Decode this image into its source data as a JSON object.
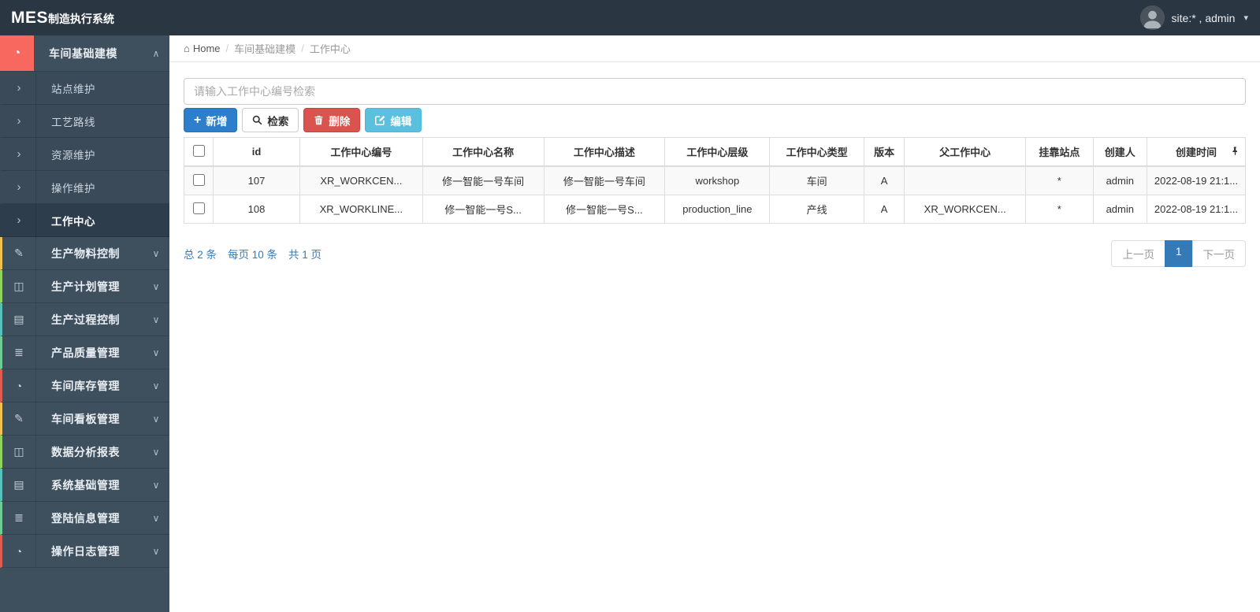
{
  "navbar": {
    "logo_bold": "MES",
    "logo_rest": "制造执行系统",
    "user_label": "site:* , admin"
  },
  "icons": {
    "home": "⌂",
    "chevron_up": "∧",
    "chevron_down": "∨",
    "chevron_right": "›",
    "caret_down": "▾",
    "plus": "+",
    "dashboard": "◔",
    "edit": "✎",
    "columns": "◫",
    "book": "▤",
    "list": "≣"
  },
  "sidebar": {
    "parent": {
      "label": "车间基础建模"
    },
    "sub_items": [
      {
        "label": "站点维护"
      },
      {
        "label": "工艺路线"
      },
      {
        "label": "资源维护"
      },
      {
        "label": "操作维护"
      },
      {
        "label": "工作中心"
      }
    ],
    "items": [
      {
        "label": "生产物料控制",
        "icon": "edit-icon",
        "accent": "#f0c052"
      },
      {
        "label": "生产计划管理",
        "icon": "columns-icon",
        "accent": "#92d35e"
      },
      {
        "label": "生产过程控制",
        "icon": "book-icon",
        "accent": "#56c2bc"
      },
      {
        "label": "产品质量管理",
        "icon": "list-icon",
        "accent": "#6ecc94"
      },
      {
        "label": "车间库存管理",
        "icon": "dashboard-icon",
        "accent": "#e05c51"
      },
      {
        "label": "车间看板管理",
        "icon": "edit-icon",
        "accent": "#f0c052"
      },
      {
        "label": "数据分析报表",
        "icon": "columns-icon",
        "accent": "#92d35e"
      },
      {
        "label": "系统基础管理",
        "icon": "book-icon",
        "accent": "#56c2bc"
      },
      {
        "label": "登陆信息管理",
        "icon": "list-icon",
        "accent": "#6ecc94"
      },
      {
        "label": "操作日志管理",
        "icon": "dashboard-icon",
        "accent": "#e05c51"
      }
    ]
  },
  "breadcrumb": {
    "home": "Home",
    "sep": "/",
    "crumb1": "车间基础建模",
    "crumb2": "工作中心"
  },
  "search": {
    "placeholder": "请输入工作中心编号检索",
    "value": ""
  },
  "toolbar": {
    "add_label": "新增",
    "search_label": "检索",
    "delete_label": "删除",
    "edit_label": "编辑"
  },
  "table": {
    "columns": [
      "id",
      "工作中心编号",
      "工作中心名称",
      "工作中心描述",
      "工作中心层级",
      "工作中心类型",
      "版本",
      "父工作中心",
      "挂靠站点",
      "创建人",
      "创建时间"
    ],
    "rows": [
      [
        "107",
        "XR_WORKCEN...",
        "修一智能一号车间",
        "修一智能一号车间",
        "workshop",
        "车间",
        "A",
        "",
        "*",
        "admin",
        "2022-08-19 21:1..."
      ],
      [
        "108",
        "XR_WORKLINE...",
        "修一智能一号S...",
        "修一智能一号S...",
        "production_line",
        "产线",
        "A",
        "XR_WORKCEN...",
        "*",
        "admin",
        "2022-08-19 21:1..."
      ]
    ]
  },
  "pagination": {
    "total": "总 2 条",
    "per_page": "每页 10 条",
    "pages": "共 1 页",
    "prev": "上一页",
    "current": "1",
    "next": "下一页"
  },
  "colors": {
    "navbar_bg": "#2b3643",
    "sidebar_bg": "#3e4f5e",
    "active_icon_bg": "#f9685f",
    "primary": "#2e7fcb",
    "danger": "#d9534f",
    "info": "#5bc0de",
    "link_blue": "#337ab7"
  }
}
